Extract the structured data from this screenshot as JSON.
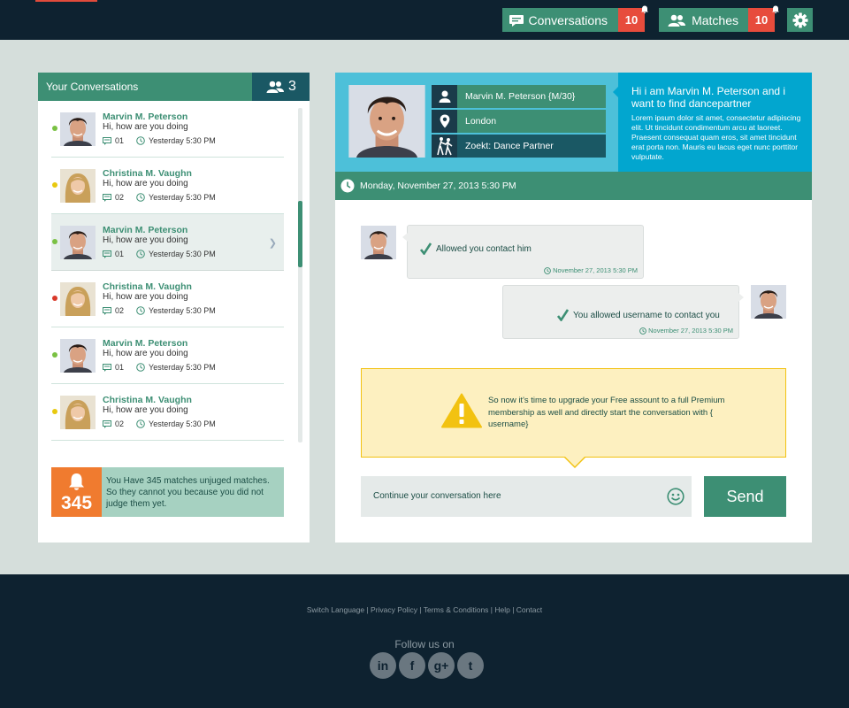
{
  "topbar": {
    "conversations_label": "Conversations",
    "conversations_count": "10",
    "matches_label": "Matches",
    "matches_count": "10"
  },
  "sidebar": {
    "title": "Your Conversations",
    "online_count": "3",
    "conversations": [
      {
        "name": "Marvin M. Peterson",
        "message": "Hi, how are you doing",
        "count": "01",
        "time": "Yesterday 5:30 PM",
        "status": "green",
        "avatar": "male",
        "active": false
      },
      {
        "name": "Christina M. Vaughn",
        "message": "Hi, how are you doing",
        "count": "02",
        "time": "Yesterday 5:30 PM",
        "status": "yellow",
        "avatar": "female",
        "active": false
      },
      {
        "name": "Marvin M. Peterson",
        "message": "Hi, how are you doing",
        "count": "01",
        "time": "Yesterday 5:30 PM",
        "status": "green",
        "avatar": "male",
        "active": true
      },
      {
        "name": "Christina M. Vaughn",
        "message": "Hi, how are you doing",
        "count": "02",
        "time": "Yesterday 5:30 PM",
        "status": "red",
        "avatar": "female",
        "active": false
      },
      {
        "name": "Marvin M. Peterson",
        "message": "Hi, how are you doing",
        "count": "01",
        "time": "Yesterday 5:30 PM",
        "status": "green",
        "avatar": "male",
        "active": false
      },
      {
        "name": "Christina M. Vaughn",
        "message": "Hi, how are you doing",
        "count": "02",
        "time": "Yesterday 5:30 PM",
        "status": "yellow",
        "avatar": "female",
        "active": false
      }
    ],
    "alert": {
      "number": "345",
      "text": "You Have 345 matches unjuged matches. So they cannot you because you did not judge them yet."
    }
  },
  "profile": {
    "name_line": "Marvin M. Peterson {M/30}",
    "location": "London",
    "seeking": "Zoekt: Dance Partner",
    "bio_title": "Hi i am Marvin M. Peterson and i want to find dancepartner",
    "bio_text": "Lorem ipsum dolor sit amet, consectetur adipiscing elit. Ut tincidunt condimentum arcu at laoreet. Praesent consequat quam eros, sit amet tincidunt erat porta non. Mauris eu lacus eget nunc porttitor vulputate."
  },
  "chat": {
    "date": "Monday, November 27, 2013 5:30 PM",
    "messages": [
      {
        "text": "Allowed you contact him",
        "time": "November 27, 2013 5:30 PM"
      },
      {
        "text": "You allowed username to contact you",
        "time": "November 27, 2013 5:30 PM"
      }
    ],
    "upgrade_notice": "So now it's time to upgrade your Free assount to a full Premium membership as well and directly start the conversation with { username}",
    "input_placeholder": "Continue your conversation here",
    "send_label": "Send"
  },
  "footer": {
    "links": [
      "Switch Language",
      "Privacy Policy",
      "Terms & Conditions",
      "Help",
      "Contact"
    ],
    "separator": " | ",
    "follow_label": "Follow us on",
    "social": [
      "in",
      "f",
      "g+",
      "t"
    ]
  },
  "colors": {
    "accent_green": "#3d8f74",
    "dark_navy": "#0e2230",
    "alert_red": "#e74c3c",
    "cyan": "#02a6cf",
    "orange": "#f07b2f"
  }
}
